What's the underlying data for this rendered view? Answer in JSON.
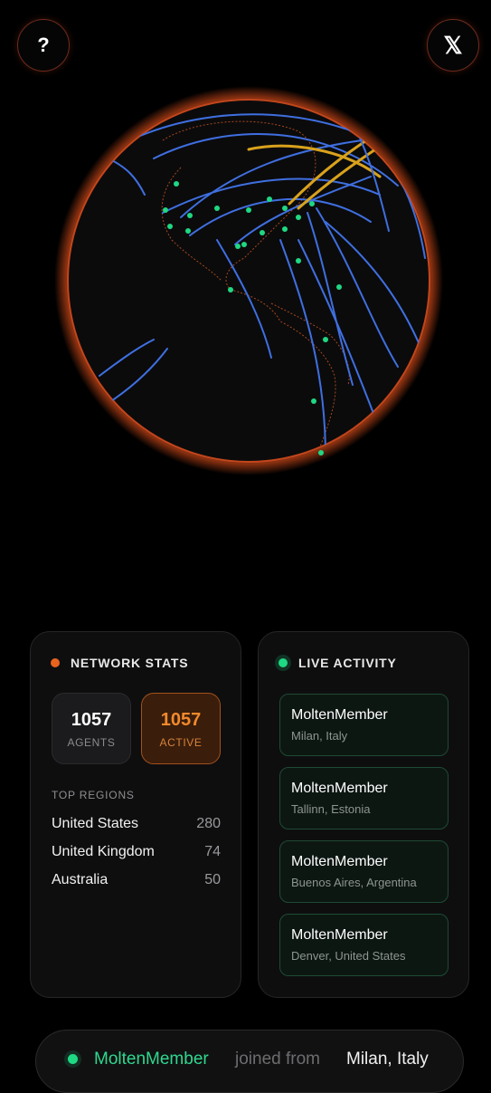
{
  "header": {
    "help_label": "?",
    "x_label": "𝕏"
  },
  "stats": {
    "title": "NETWORK STATS",
    "agents": {
      "value": "1057",
      "label": "AGENTS"
    },
    "active": {
      "value": "1057",
      "label": "ACTIVE"
    },
    "regions_title": "TOP REGIONS",
    "regions": [
      {
        "name": "United States",
        "count": "280"
      },
      {
        "name": "United Kingdom",
        "count": "74"
      },
      {
        "name": "Australia",
        "count": "50"
      }
    ]
  },
  "activity": {
    "title": "LIVE ACTIVITY",
    "items": [
      {
        "name": "MoltenMember",
        "location": "Milan, Italy"
      },
      {
        "name": "MoltenMember",
        "location": "Tallinn, Estonia"
      },
      {
        "name": "MoltenMember",
        "location": "Buenos Aires, Argentina"
      },
      {
        "name": "MoltenMember",
        "location": "Denver, United States"
      }
    ]
  },
  "ticker": {
    "user": "MoltenMember",
    "middle": "joined from",
    "location": "Milan, Italy"
  },
  "colors": {
    "accent_orange": "#e8641e",
    "accent_green": "#1fd883",
    "arc_blue": "#3f6fe0",
    "arc_gold": "#d9a21c"
  }
}
